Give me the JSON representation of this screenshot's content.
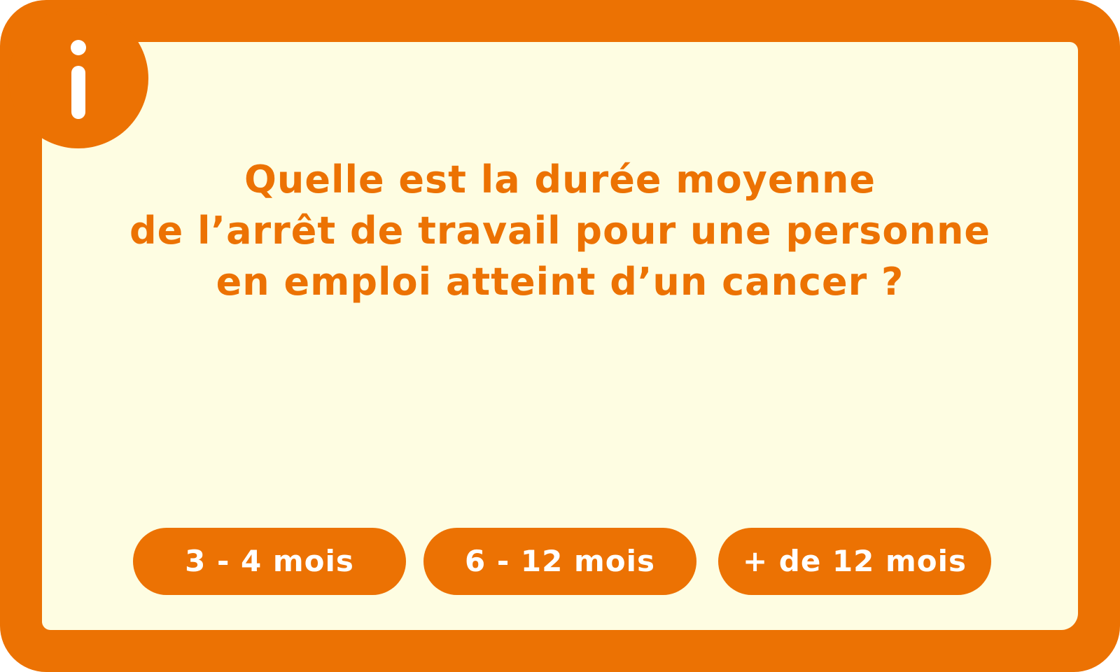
{
  "colors": {
    "accent": "#ec7203",
    "panel_background": "#fefde2",
    "button_text": "#ffffff"
  },
  "badge": {
    "icon": "info-icon"
  },
  "question": {
    "lines": [
      "Quelle est la durée moyenne",
      "de l’arrêt de travail pour une personne",
      "en emploi atteint d’un cancer ?"
    ]
  },
  "answers": [
    {
      "label": "3 - 4 mois"
    },
    {
      "label": "6 - 12 mois"
    },
    {
      "label": "+ de 12 mois"
    }
  ]
}
